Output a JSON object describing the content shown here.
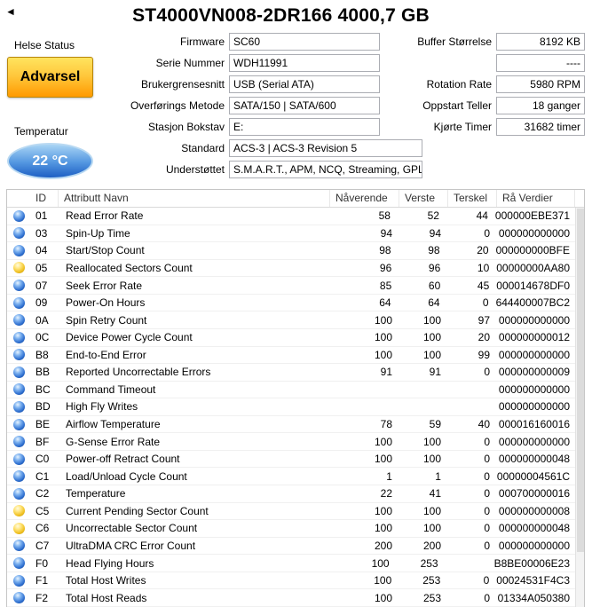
{
  "colors": {
    "warning_top": "#ffe45e",
    "warning_bottom": "#ff9a00",
    "temp_top": "#a8d4f5",
    "temp_bottom": "#1d5fc4",
    "dot_good": "#2e6fd0",
    "dot_caution": "#f0c020"
  },
  "header": {
    "back_icon": "◄",
    "title": "ST4000VN008-2DR166 4000,7 GB"
  },
  "health": {
    "label": "Helse Status",
    "status_button": "Advarsel"
  },
  "temperature": {
    "label": "Temperatur",
    "value": "22 °C"
  },
  "info_mid": {
    "fields": [
      {
        "label": "Firmware",
        "value": "SC60"
      },
      {
        "label": "Serie Nummer",
        "value": "WDH11991"
      },
      {
        "label": "Brukergrensesnitt",
        "value": "USB (Serial ATA)"
      },
      {
        "label": "Overførings Metode",
        "value": "SATA/150 | SATA/600"
      },
      {
        "label": "Stasjon Bokstav",
        "value": "E:"
      },
      {
        "label": "Standard",
        "value": "ACS-3 | ACS-3 Revision 5"
      },
      {
        "label": "Understøttet",
        "value": "S.M.A.R.T., APM, NCQ, Streaming, GPL"
      }
    ]
  },
  "info_right": {
    "fields": [
      {
        "label": "Buffer Størrelse",
        "value": "8192 KB"
      },
      {
        "label": "",
        "value": "----"
      },
      {
        "label": "Rotation Rate",
        "value": "5980 RPM"
      },
      {
        "label": "Oppstart Teller",
        "value": "18 ganger"
      },
      {
        "label": "Kjørte Timer",
        "value": "31682 timer"
      }
    ]
  },
  "table": {
    "headers": {
      "id": "ID",
      "name": "Attributt Navn",
      "current": "Nåverende",
      "worst": "Verste",
      "threshold": "Terskel",
      "raw": "Rå Verdier"
    },
    "rows": [
      {
        "status": "good",
        "id": "01",
        "name": "Read Error Rate",
        "current": "58",
        "worst": "52",
        "threshold": "44",
        "raw": "000000EBE371"
      },
      {
        "status": "good",
        "id": "03",
        "name": "Spin-Up Time",
        "current": "94",
        "worst": "94",
        "threshold": "0",
        "raw": "000000000000"
      },
      {
        "status": "good",
        "id": "04",
        "name": "Start/Stop Count",
        "current": "98",
        "worst": "98",
        "threshold": "20",
        "raw": "000000000BFE"
      },
      {
        "status": "caution",
        "id": "05",
        "name": "Reallocated Sectors Count",
        "current": "96",
        "worst": "96",
        "threshold": "10",
        "raw": "00000000AA80"
      },
      {
        "status": "good",
        "id": "07",
        "name": "Seek Error Rate",
        "current": "85",
        "worst": "60",
        "threshold": "45",
        "raw": "000014678DF0"
      },
      {
        "status": "good",
        "id": "09",
        "name": "Power-On Hours",
        "current": "64",
        "worst": "64",
        "threshold": "0",
        "raw": "644400007BC2"
      },
      {
        "status": "good",
        "id": "0A",
        "name": "Spin Retry Count",
        "current": "100",
        "worst": "100",
        "threshold": "97",
        "raw": "000000000000"
      },
      {
        "status": "good",
        "id": "0C",
        "name": "Device Power Cycle Count",
        "current": "100",
        "worst": "100",
        "threshold": "20",
        "raw": "000000000012"
      },
      {
        "status": "good",
        "id": "B8",
        "name": "End-to-End Error",
        "current": "100",
        "worst": "100",
        "threshold": "99",
        "raw": "000000000000"
      },
      {
        "status": "good",
        "id": "BB",
        "name": "Reported Uncorrectable Errors",
        "current": "91",
        "worst": "91",
        "threshold": "0",
        "raw": "000000000009"
      },
      {
        "status": "good",
        "id": "BC",
        "name": "Command Timeout",
        "current": "",
        "worst": "",
        "threshold": "",
        "raw": "000000000000"
      },
      {
        "status": "good",
        "id": "BD",
        "name": "High Fly Writes",
        "current": "",
        "worst": "",
        "threshold": "",
        "raw": "000000000000"
      },
      {
        "status": "good",
        "id": "BE",
        "name": "Airflow Temperature",
        "current": "78",
        "worst": "59",
        "threshold": "40",
        "raw": "000016160016"
      },
      {
        "status": "good",
        "id": "BF",
        "name": "G-Sense Error Rate",
        "current": "100",
        "worst": "100",
        "threshold": "0",
        "raw": "000000000000"
      },
      {
        "status": "good",
        "id": "C0",
        "name": "Power-off Retract Count",
        "current": "100",
        "worst": "100",
        "threshold": "0",
        "raw": "000000000048"
      },
      {
        "status": "good",
        "id": "C1",
        "name": "Load/Unload Cycle Count",
        "current": "1",
        "worst": "1",
        "threshold": "0",
        "raw": "00000004561C"
      },
      {
        "status": "good",
        "id": "C2",
        "name": "Temperature",
        "current": "22",
        "worst": "41",
        "threshold": "0",
        "raw": "000700000016"
      },
      {
        "status": "caution",
        "id": "C5",
        "name": "Current Pending Sector Count",
        "current": "100",
        "worst": "100",
        "threshold": "0",
        "raw": "000000000008"
      },
      {
        "status": "caution",
        "id": "C6",
        "name": "Uncorrectable Sector Count",
        "current": "100",
        "worst": "100",
        "threshold": "0",
        "raw": "000000000048"
      },
      {
        "status": "good",
        "id": "C7",
        "name": "UltraDMA CRC Error Count",
        "current": "200",
        "worst": "200",
        "threshold": "0",
        "raw": "000000000000"
      },
      {
        "status": "good",
        "id": "F0",
        "name": "Head Flying Hours",
        "current": "100",
        "worst": "253",
        "threshold": "",
        "raw": "B8BE00006E23"
      },
      {
        "status": "good",
        "id": "F1",
        "name": "Total Host Writes",
        "current": "100",
        "worst": "253",
        "threshold": "0",
        "raw": "00024531F4C3"
      },
      {
        "status": "good",
        "id": "F2",
        "name": "Total Host Reads",
        "current": "100",
        "worst": "253",
        "threshold": "0",
        "raw": "01334A050380"
      }
    ]
  }
}
